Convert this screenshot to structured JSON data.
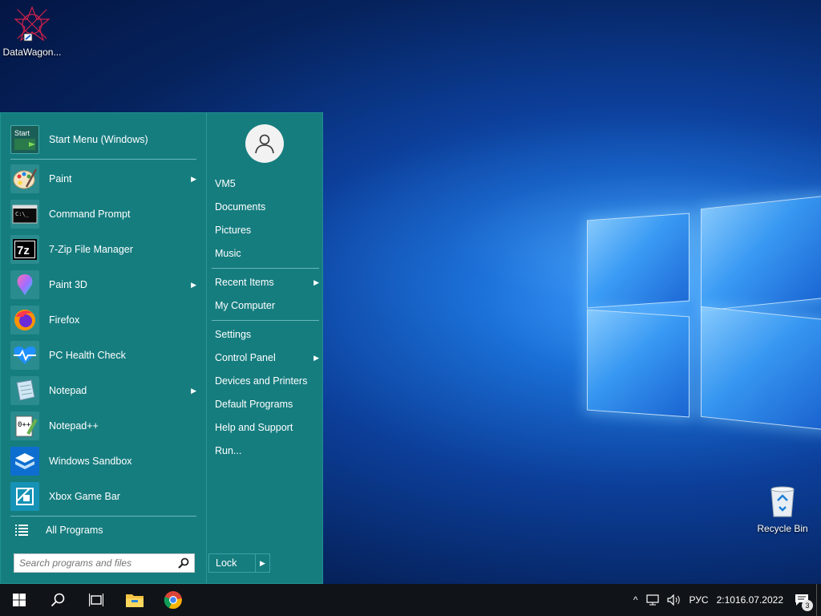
{
  "desktop": {
    "icons": [
      {
        "label": "DataWagon..."
      },
      {
        "label": "Recycle Bin"
      }
    ]
  },
  "start_menu": {
    "header": {
      "label": "Start Menu (Windows)"
    },
    "programs": [
      {
        "label": "Paint",
        "arrow": "▶",
        "icon": "paint-icon"
      },
      {
        "label": "Command Prompt",
        "arrow": "",
        "icon": "command-prompt-icon"
      },
      {
        "label": "7-Zip File Manager",
        "arrow": "",
        "icon": "7zip-icon"
      },
      {
        "label": "Paint 3D",
        "arrow": "▶",
        "icon": "paint-3d-icon"
      },
      {
        "label": "Firefox",
        "arrow": "",
        "icon": "firefox-icon"
      },
      {
        "label": "PC Health Check",
        "arrow": "",
        "icon": "pc-health-check-icon"
      },
      {
        "label": "Notepad",
        "arrow": "▶",
        "icon": "notepad-icon"
      },
      {
        "label": "Notepad++",
        "arrow": "",
        "icon": "notepad-plus-plus-icon"
      },
      {
        "label": "Windows Sandbox",
        "arrow": "",
        "icon": "windows-sandbox-icon"
      },
      {
        "label": "Xbox Game Bar",
        "arrow": "",
        "icon": "xbox-game-bar-icon"
      }
    ],
    "all_programs": "All Programs",
    "search_placeholder": "Search programs and files",
    "right": {
      "user": "VM5",
      "documents": "Documents",
      "pictures": "Pictures",
      "music": "Music",
      "recent_items": "Recent Items",
      "my_computer": "My Computer",
      "settings": "Settings",
      "control_panel": "Control Panel",
      "devices_printers": "Devices and Printers",
      "default_programs": "Default Programs",
      "help_support": "Help and Support",
      "run": "Run...",
      "arrow": "▶"
    },
    "lock": {
      "label": "Lock",
      "arrow": "▶"
    }
  },
  "taskbar": {
    "tray_arrow": "^",
    "language": "РУС",
    "time": "2:10",
    "date": "16.07.2022",
    "notification_count": "3"
  },
  "colors": {
    "menu_bg": "#167d7f",
    "taskbar_bg": "#101418",
    "accent_light": "#8ccfd1"
  }
}
